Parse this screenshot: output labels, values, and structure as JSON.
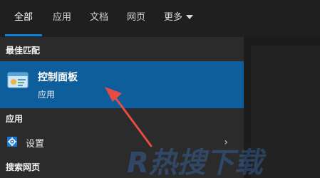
{
  "tabs": [
    {
      "label": "全部",
      "active": true
    },
    {
      "label": "应用",
      "active": false
    },
    {
      "label": "文档",
      "active": false
    },
    {
      "label": "网页",
      "active": false
    },
    {
      "label": "更多",
      "active": false,
      "has_dropdown": true
    }
  ],
  "accent_color": "#0a84d8",
  "highlight_color": "#0f5e9c",
  "sections": {
    "best_match_header": "最佳匹配",
    "apps_header": "应用",
    "web_header": "搜索网页"
  },
  "best_match": {
    "title": "控制面板",
    "subtitle": "应用",
    "icon": "control-panel-icon"
  },
  "apps": [
    {
      "label": "设置",
      "icon": "settings-gear-icon",
      "has_chevron": true
    }
  ],
  "annotation": {
    "arrow_color": "#e84a44"
  },
  "watermark": {
    "text": "R热搜下载"
  }
}
